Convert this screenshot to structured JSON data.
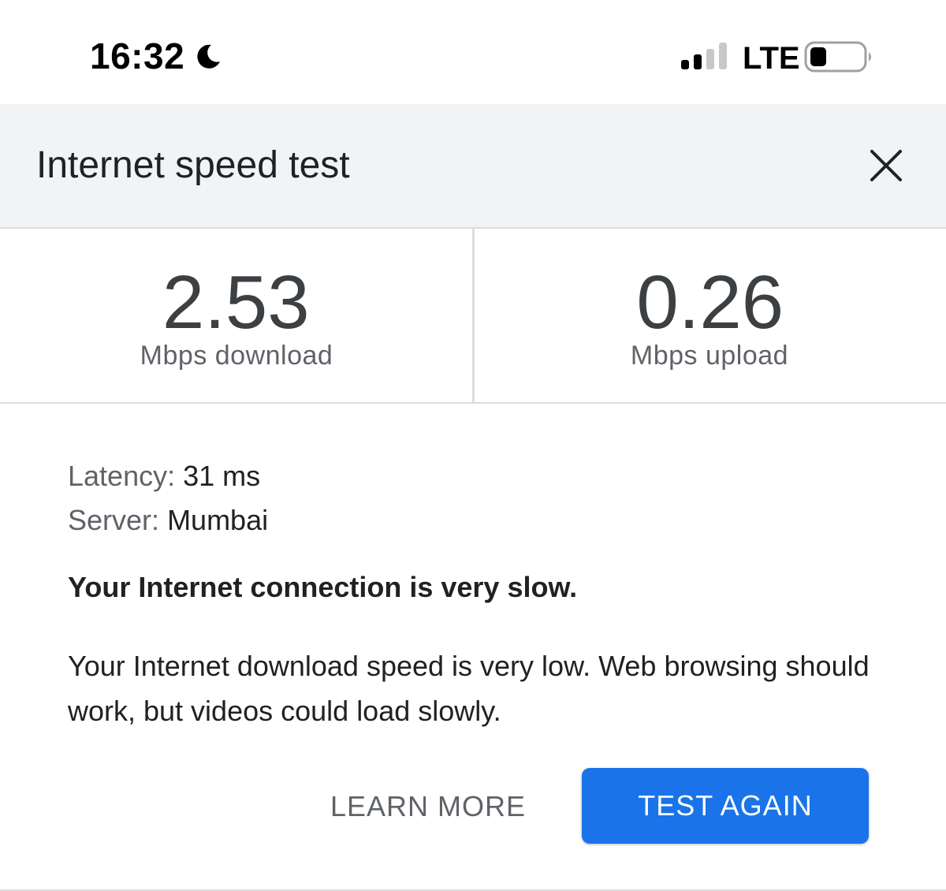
{
  "status_bar": {
    "time": "16:32",
    "focus_icon": "moon-icon",
    "signal_icon": "cellular-signal-icon",
    "signal_bars": 2,
    "signal_bars_total": 4,
    "network": "LTE",
    "battery_icon": "battery-icon",
    "battery_level": 0.25
  },
  "header": {
    "title": "Internet speed test",
    "close_icon": "close-icon"
  },
  "results": {
    "download_value": "2.53",
    "download_label": "Mbps download",
    "upload_value": "0.26",
    "upload_label": "Mbps upload"
  },
  "details": {
    "latency_key": "Latency:",
    "latency_value": "31 ms",
    "server_key": "Server:",
    "server_value": "Mumbai"
  },
  "verdict": "Your Internet connection is very slow.",
  "description": "Your Internet download speed is very low. Web browsing should work, but videos could load slowly.",
  "actions": {
    "learn_more": "LEARN MORE",
    "test_again": "TEST AGAIN"
  },
  "colors": {
    "accent": "#1a73e8",
    "header_bg": "#f1f3f4",
    "divider": "#dadce0"
  }
}
